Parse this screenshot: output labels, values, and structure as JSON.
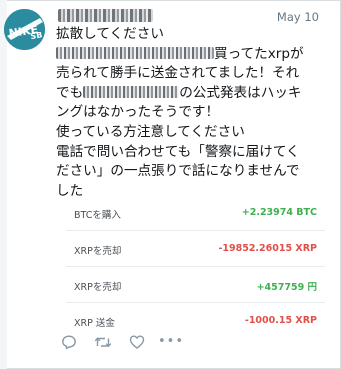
{
  "tweet": {
    "date": "May 10",
    "lines": {
      "l1": "拡散してください",
      "l2_tail": "買ってたxrpが",
      "l3": "売られて勝手に送金されてました！それ",
      "l4_head": "でも",
      "l4_tail": "の公式発表はハッキ",
      "l5": "ングはなかったそうです！",
      "l6": "使っている方注意してください",
      "l7": "電話で問い合わせても「警察に届けてく",
      "l8": "ださい」の一点張りで話になりませんで",
      "l9": "した"
    }
  },
  "trades": [
    {
      "label": "BTCを購入",
      "amount": "+2.23974 BTC",
      "color": "#3fb04f"
    },
    {
      "label": "XRPを売却",
      "amount": "-19852.26015 XRP",
      "color": "#e0504a"
    },
    {
      "label": "XRPを売却",
      "amount": "+457759 円",
      "color": "#3fb04f"
    },
    {
      "label": "XRP 送金",
      "amount": "-1000.15 XRP",
      "color": "#e0504a"
    }
  ],
  "actions": {
    "reply_icon": "reply-icon",
    "retweet_icon": "retweet-icon",
    "like_icon": "heart-icon",
    "more": "•••"
  },
  "avatar": {
    "brand": "NIKE SB",
    "brand_line1": "NIKE",
    "brand_line2": "SB"
  }
}
